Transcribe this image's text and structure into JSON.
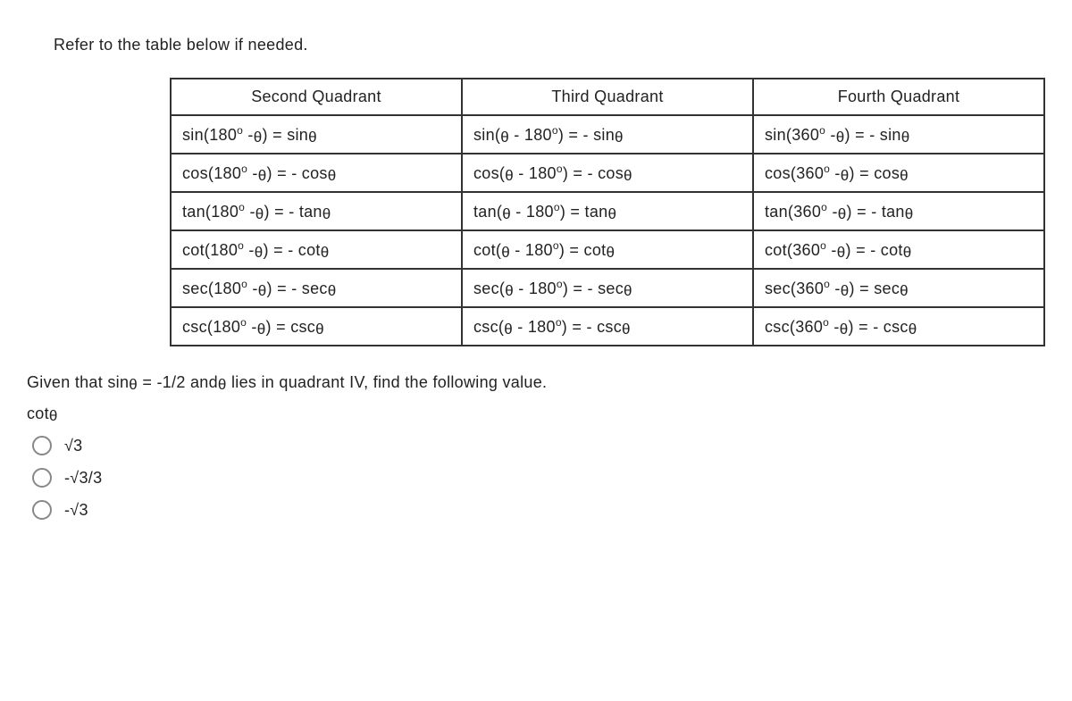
{
  "instruction": "Refer to the table below if needed.",
  "table": {
    "headers": [
      "Second Quadrant",
      "Third Quadrant",
      "Fourth Quadrant"
    ],
    "rows": [
      [
        "sin(180° -θ) = sinθ",
        "sin(θ - 180°) = - sinθ",
        "sin(360° -θ) = - sinθ"
      ],
      [
        "cos(180° -θ) = - cosθ",
        "cos(θ - 180°) = - cosθ",
        "cos(360° -θ) = cosθ"
      ],
      [
        "tan(180° -θ) = - tanθ",
        "tan(θ - 180°) = tanθ",
        "tan(360° -θ) = - tanθ"
      ],
      [
        "cot(180° -θ) = - cotθ",
        "cot(θ - 180°) = cotθ",
        "cot(360° -θ) = - cotθ"
      ],
      [
        "sec(180° -θ) = - secθ",
        "sec(θ - 180°) = - secθ",
        "sec(360° -θ) = secθ"
      ],
      [
        "csc(180° -θ) = cscθ",
        "csc(θ - 180°) = - cscθ",
        "csc(360° -θ) = - cscθ"
      ]
    ]
  },
  "prompt": "Given that sinθ = -1/2 andθ lies in quadrant IV, find the following value.",
  "ask": "cotθ",
  "options": [
    "√3",
    "-√3/3",
    "-√3"
  ]
}
